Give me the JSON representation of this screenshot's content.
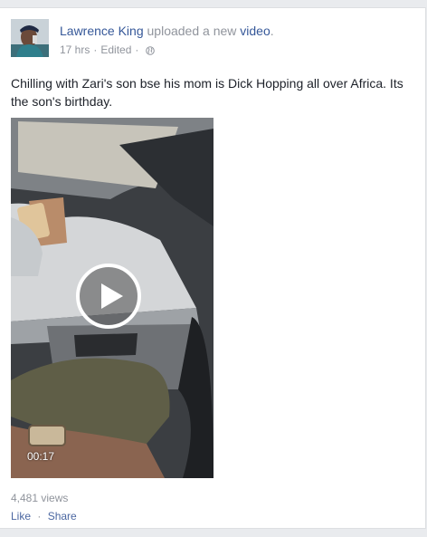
{
  "post": {
    "author": "Lawrence King",
    "action_text": "uploaded a new",
    "object_link": "video",
    "period": ".",
    "time": "17 hrs",
    "separator": "·",
    "edited": "Edited",
    "privacy_icon": "globe-icon",
    "status": "Chilling with Zari's son bse his mom is Dick Hopping all over Africa. Its the son's birthday."
  },
  "video": {
    "duration": "00:17",
    "play_icon": "play-icon",
    "views": "4,481 views"
  },
  "actions": {
    "like": "Like",
    "separator": "·",
    "share": "Share"
  },
  "colors": {
    "link": "#365899",
    "meta": "#90949c",
    "text": "#1d2129",
    "background": "#e9ebee"
  }
}
